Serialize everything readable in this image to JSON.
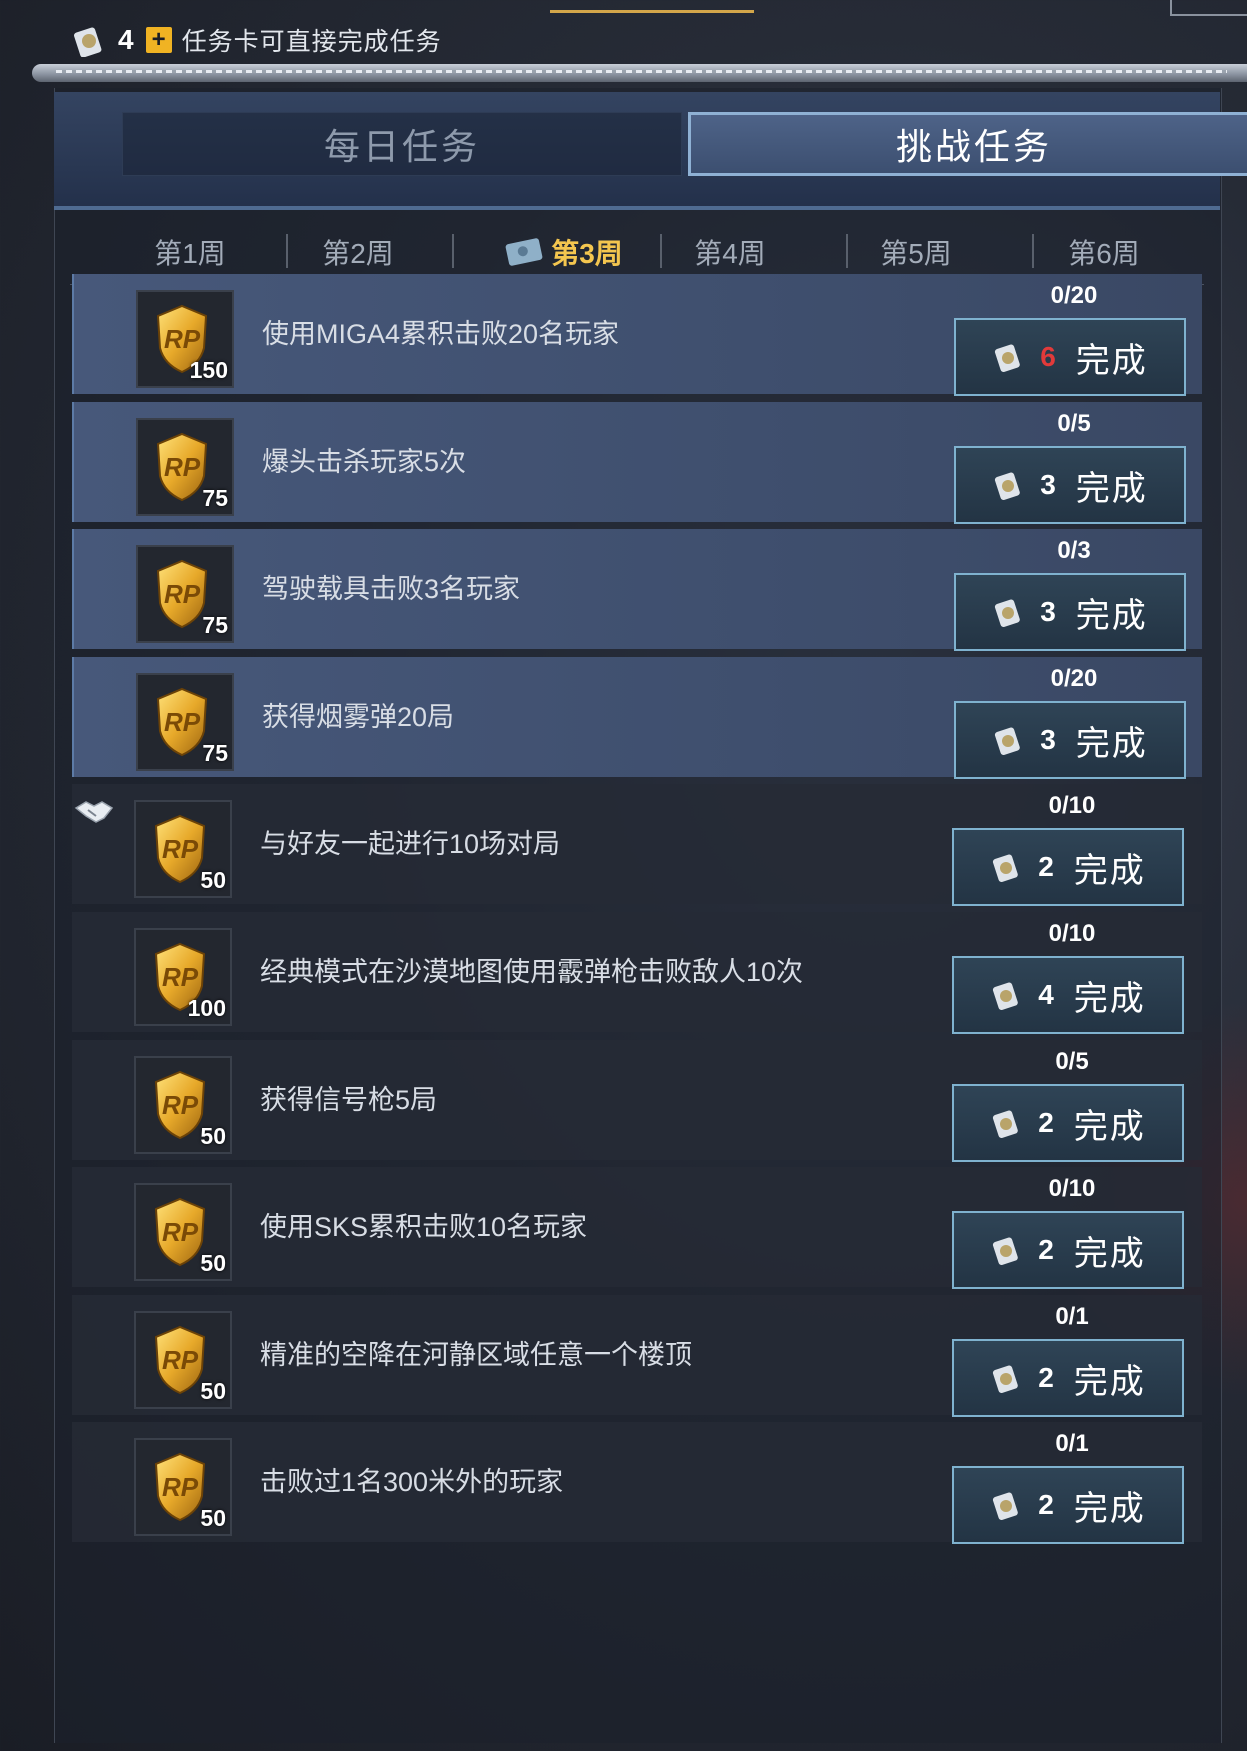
{
  "header": {
    "card_count": "4",
    "plus_label": "+",
    "card_hint": "任务卡可直接完成任务"
  },
  "main_tabs": [
    {
      "label": "每日任务",
      "active": false
    },
    {
      "label": "挑战任务",
      "active": true
    }
  ],
  "weeks": [
    {
      "label": "第1周",
      "active": false
    },
    {
      "label": "第2周",
      "active": false
    },
    {
      "label": "第3周",
      "active": true
    },
    {
      "label": "第4周",
      "active": false
    },
    {
      "label": "第5周",
      "active": false
    },
    {
      "label": "第6周",
      "active": false
    }
  ],
  "tasks": [
    {
      "title": "使用MIGA4累积击败20名玩家",
      "reward": "150",
      "progress": "0/20",
      "cost": "6",
      "cost_color": "#e23a3a",
      "button": "完成"
    },
    {
      "title": "爆头击杀玩家5次",
      "reward": "75",
      "progress": "0/5",
      "cost": "3",
      "button": "完成"
    },
    {
      "title": "驾驶载具击败3名玩家",
      "reward": "75",
      "progress": "0/3",
      "cost": "3",
      "button": "完成"
    },
    {
      "title": "获得烟雾弹20局",
      "reward": "75",
      "progress": "0/20",
      "cost": "3",
      "button": "完成"
    },
    {
      "title": "与好友一起进行10场对局",
      "reward": "50",
      "progress": "0/10",
      "cost": "2",
      "button": "完成"
    },
    {
      "title": "经典模式在沙漠地图使用霰弹枪击败敌人10次",
      "reward": "100",
      "progress": "0/10",
      "cost": "4",
      "button": "完成"
    },
    {
      "title": "获得信号枪5局",
      "reward": "50",
      "progress": "0/5",
      "cost": "2",
      "button": "完成"
    },
    {
      "title": "使用SKS累积击败10名玩家",
      "reward": "50",
      "progress": "0/10",
      "cost": "2",
      "button": "完成"
    },
    {
      "title": "精准的空降在河静区域任意一个楼顶",
      "reward": "50",
      "progress": "0/1",
      "cost": "2",
      "button": "完成"
    },
    {
      "title": "击败过1名300米外的玩家",
      "reward": "50",
      "progress": "0/1",
      "cost": "2",
      "button": "完成"
    }
  ],
  "colors": {
    "accent": "#f4c64f",
    "button_border": "#7fb2cf",
    "highlight_cost": "#e23a3a"
  }
}
